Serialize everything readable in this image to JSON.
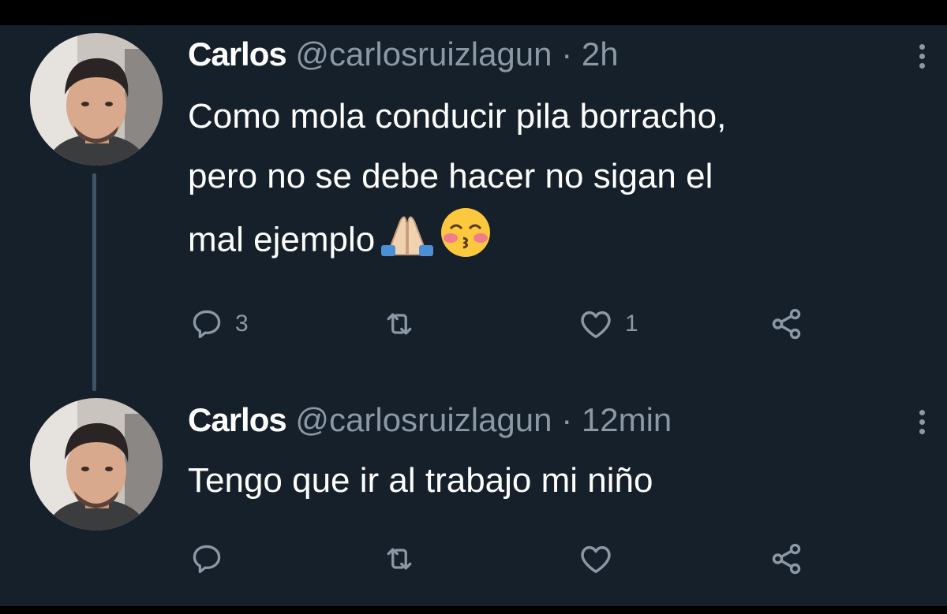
{
  "tweets": [
    {
      "name": "Carlos",
      "handle": "@carlosruizlagun",
      "separator": "·",
      "time": "2h",
      "text": "Como mola conducir pila borracho,\npero no se debe hacer no sigan el\nmal ejemplo",
      "emojis": [
        "folded-hands",
        "kissing-face-with-closed-eyes"
      ],
      "reply_count": "3",
      "retweet_count": "",
      "like_count": "1"
    },
    {
      "name": "Carlos",
      "handle": "@carlosruizlagun",
      "separator": "·",
      "time": "12min",
      "text": "Tengo que ir al trabajo mi niño",
      "reply_count": "",
      "retweet_count": "",
      "like_count": ""
    }
  ],
  "colors": {
    "background": "#15202b",
    "secondary_text": "#8b98a5",
    "primary_text": "#ffffff",
    "thread_line": "#3d5466"
  },
  "icons": [
    "reply-icon",
    "retweet-icon",
    "like-icon",
    "share-icon",
    "more-icon"
  ]
}
